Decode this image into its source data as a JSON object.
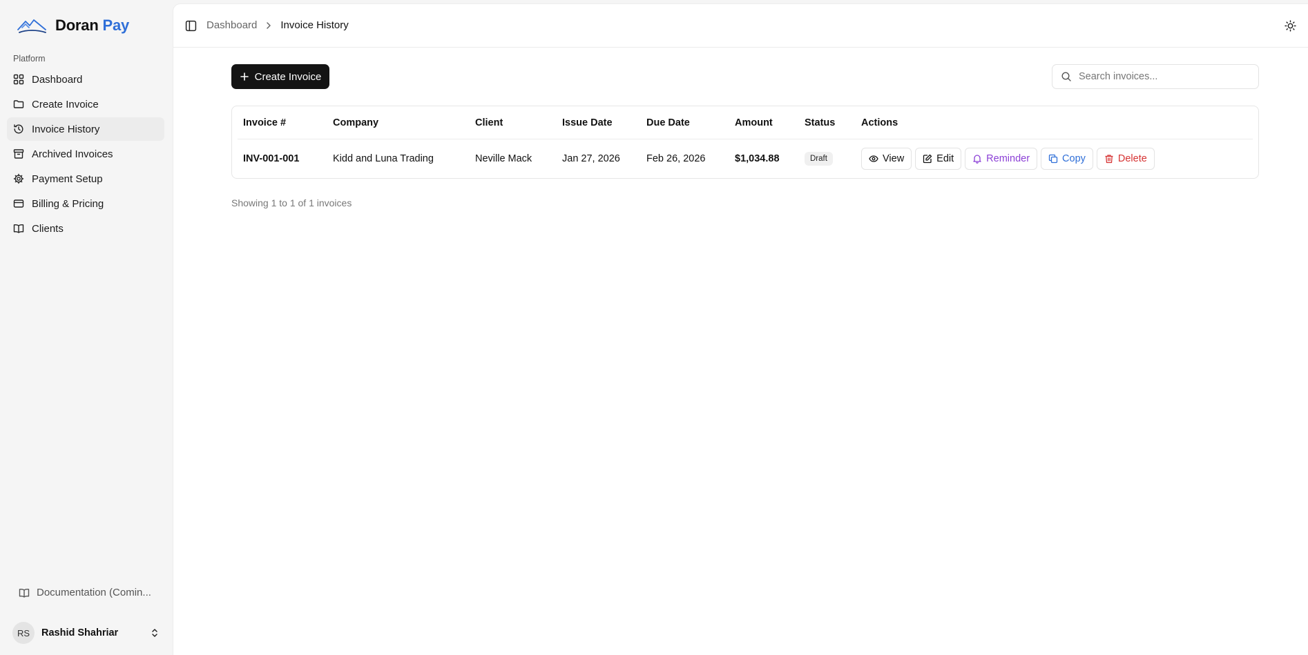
{
  "app": {
    "brand_main": "Doran",
    "brand_accent": "Pay",
    "accent_color": "#2f6fd8"
  },
  "sidebar": {
    "section_label": "Platform",
    "items": [
      {
        "label": "Dashboard",
        "icon": "layout-grid-icon"
      },
      {
        "label": "Create Invoice",
        "icon": "folder-icon"
      },
      {
        "label": "Invoice History",
        "icon": "history-icon",
        "active": true
      },
      {
        "label": "Archived Invoices",
        "icon": "archive-icon"
      },
      {
        "label": "Payment Setup",
        "icon": "gear-icon"
      },
      {
        "label": "Billing & Pricing",
        "icon": "credit-card-icon"
      },
      {
        "label": "Clients",
        "icon": "book-open-icon"
      }
    ],
    "documentation": "Documentation (Comin...",
    "user": {
      "initials": "RS",
      "name": "Rashid Shahriar"
    }
  },
  "header": {
    "breadcrumb": {
      "parent": "Dashboard",
      "current": "Invoice History"
    }
  },
  "toolbar": {
    "create_label": "Create Invoice",
    "search_placeholder": "Search invoices..."
  },
  "table": {
    "headers": [
      "Invoice #",
      "Company",
      "Client",
      "Issue Date",
      "Due Date",
      "Amount",
      "Status",
      "Actions"
    ],
    "rows": [
      {
        "invoice": "INV-001-001",
        "company": "Kidd and Luna Trading",
        "client": "Neville Mack",
        "issue_date": "Jan 27, 2026",
        "due_date": "Feb 26, 2026",
        "amount": "$1,034.88",
        "status": "Draft",
        "actions": {
          "view": "View",
          "edit": "Edit",
          "reminder": "Reminder",
          "copy": "Copy",
          "delete": "Delete"
        }
      }
    ],
    "action_colors": {
      "reminder": "#8b3fd6",
      "copy": "#2f6fd8",
      "delete": "#d63333"
    }
  },
  "pagination": {
    "summary": "Showing 1 to 1 of 1 invoices"
  }
}
